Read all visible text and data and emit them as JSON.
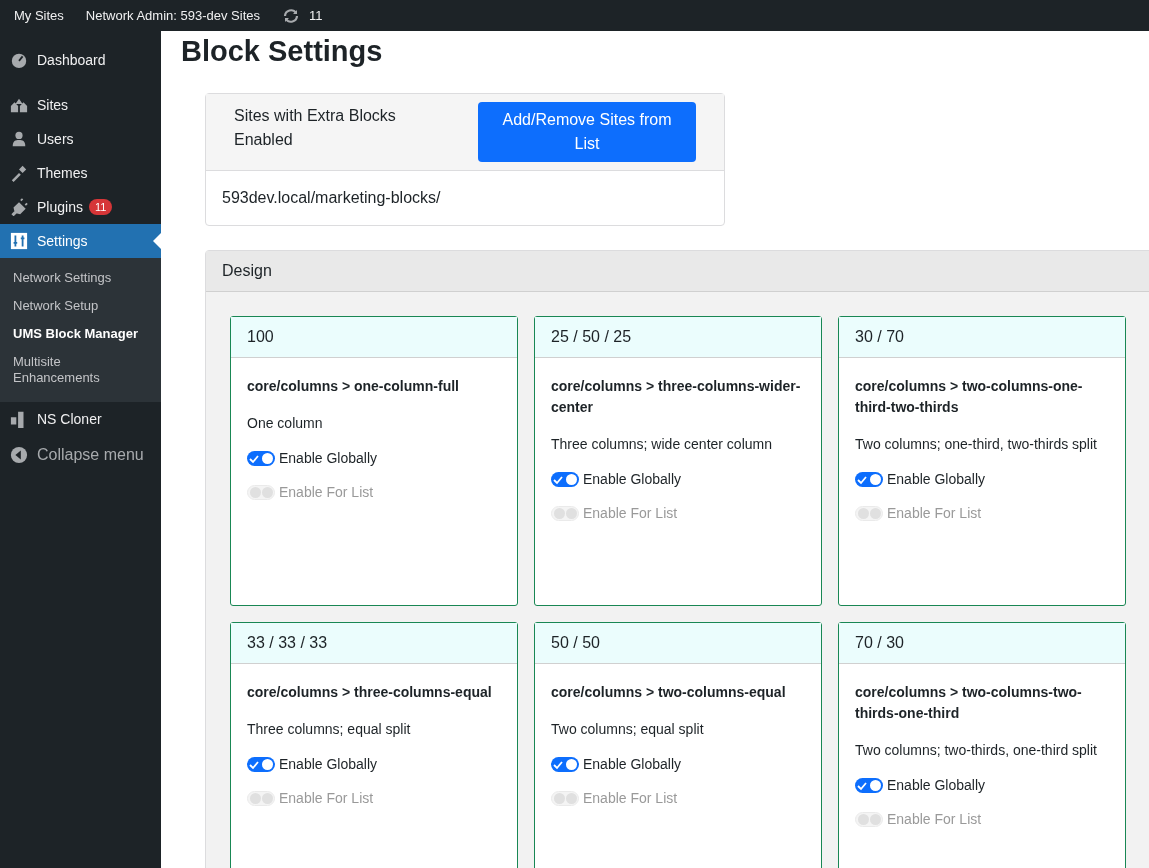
{
  "admin_bar": {
    "items": [
      "My Sites",
      "Network Admin: 593-dev Sites"
    ],
    "updates_count": "11"
  },
  "sidebar": {
    "items": [
      {
        "kind": "dashboard",
        "label": "Dashboard",
        "selected": false
      },
      {
        "kind": "sites",
        "label": "Sites",
        "selected": false
      },
      {
        "kind": "users",
        "label": "Users",
        "selected": false
      },
      {
        "kind": "themes",
        "label": "Themes",
        "selected": false
      },
      {
        "kind": "plugins",
        "label": "Plugins",
        "selected": false,
        "badge": "11"
      },
      {
        "kind": "settings",
        "label": "Settings",
        "selected": true,
        "children": [
          {
            "label": "Network Settings",
            "selected": false
          },
          {
            "label": "Network Setup",
            "selected": false
          },
          {
            "label": "UMS Block Manager",
            "selected": true
          },
          {
            "label": "Multisite Enhancements",
            "selected": false
          }
        ]
      },
      {
        "kind": "cloner",
        "label": "NS Cloner",
        "selected": false
      }
    ],
    "collapse": "Collapse menu"
  },
  "page_title": "Block Settings",
  "sites_box": {
    "title": "Sites with Extra Blocks Enabled",
    "button": "Add/Remove Sites from List",
    "sites": [
      "593dev.local/marketing-blocks/"
    ]
  },
  "design": {
    "title": "Design",
    "cards": [
      {
        "header": "100",
        "slug": "core/columns > one-column-full",
        "description": "One column",
        "toggles": [
          {
            "label": "Enable Globally",
            "on": true,
            "disabled": false
          },
          {
            "label": "Enable For List",
            "on": false,
            "disabled": true
          }
        ]
      },
      {
        "header": "25 / 50 / 25",
        "slug": "core/columns > three-columns-wider-center",
        "description": "Three columns; wide center column",
        "toggles": [
          {
            "label": "Enable Globally",
            "on": true,
            "disabled": false
          },
          {
            "label": "Enable For List",
            "on": false,
            "disabled": true
          }
        ]
      },
      {
        "header": "30 / 70",
        "slug": "core/columns > two-columns-one-third-two-thirds",
        "description": "Two columns; one-third, two-thirds split",
        "toggles": [
          {
            "label": "Enable Globally",
            "on": true,
            "disabled": false
          },
          {
            "label": "Enable For List",
            "on": false,
            "disabled": true
          }
        ]
      },
      {
        "header": "33 / 33 / 33",
        "slug": "core/columns > three-columns-equal",
        "description": "Three columns; equal split",
        "toggles": [
          {
            "label": "Enable Globally",
            "on": true,
            "disabled": false
          },
          {
            "label": "Enable For List",
            "on": false,
            "disabled": true
          }
        ]
      },
      {
        "header": "50 / 50",
        "slug": "core/columns > two-columns-equal",
        "description": "Two columns; equal split",
        "toggles": [
          {
            "label": "Enable Globally",
            "on": true,
            "disabled": false
          },
          {
            "label": "Enable For List",
            "on": false,
            "disabled": true
          }
        ]
      },
      {
        "header": "70 / 30",
        "slug": "core/columns > two-columns-two-thirds-one-third",
        "description": "Two columns; two-thirds, one-third split",
        "toggles": [
          {
            "label": "Enable Globally",
            "on": true,
            "disabled": false
          },
          {
            "label": "Enable For List",
            "on": false,
            "disabled": true
          }
        ]
      }
    ]
  }
}
